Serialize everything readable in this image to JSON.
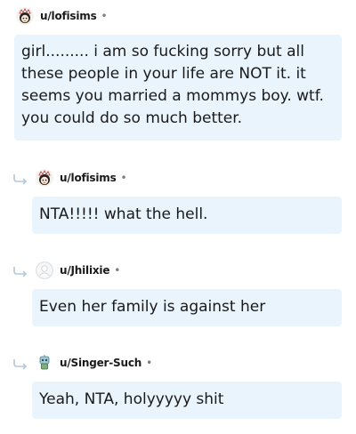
{
  "comments": [
    {
      "username": "u/lofisims",
      "separator": "•",
      "avatar": "lofisims-avatar-icon",
      "is_reply": false,
      "text": "girl......... i am so fucking sorry but all these people in your life are NOT it. it seems you married a mommys boy. wtf. you could do so much better."
    },
    {
      "username": "u/lofisims",
      "separator": "•",
      "avatar": "lofisims-avatar-icon",
      "is_reply": true,
      "text": "NTA!!!!! what the hell."
    },
    {
      "username": "u/Jhilixie",
      "separator": "•",
      "avatar": "default-avatar-icon",
      "is_reply": true,
      "text": "Even her family is against her"
    },
    {
      "username": "u/Singer-Such",
      "separator": "•",
      "avatar": "robot-avatar-icon",
      "is_reply": true,
      "text": "Yeah, NTA, holyyyyy shit"
    }
  ],
  "colors": {
    "bubble_background": "#e9f4fc",
    "text": "#1a1a1b",
    "meta": "#7c7c7c"
  }
}
